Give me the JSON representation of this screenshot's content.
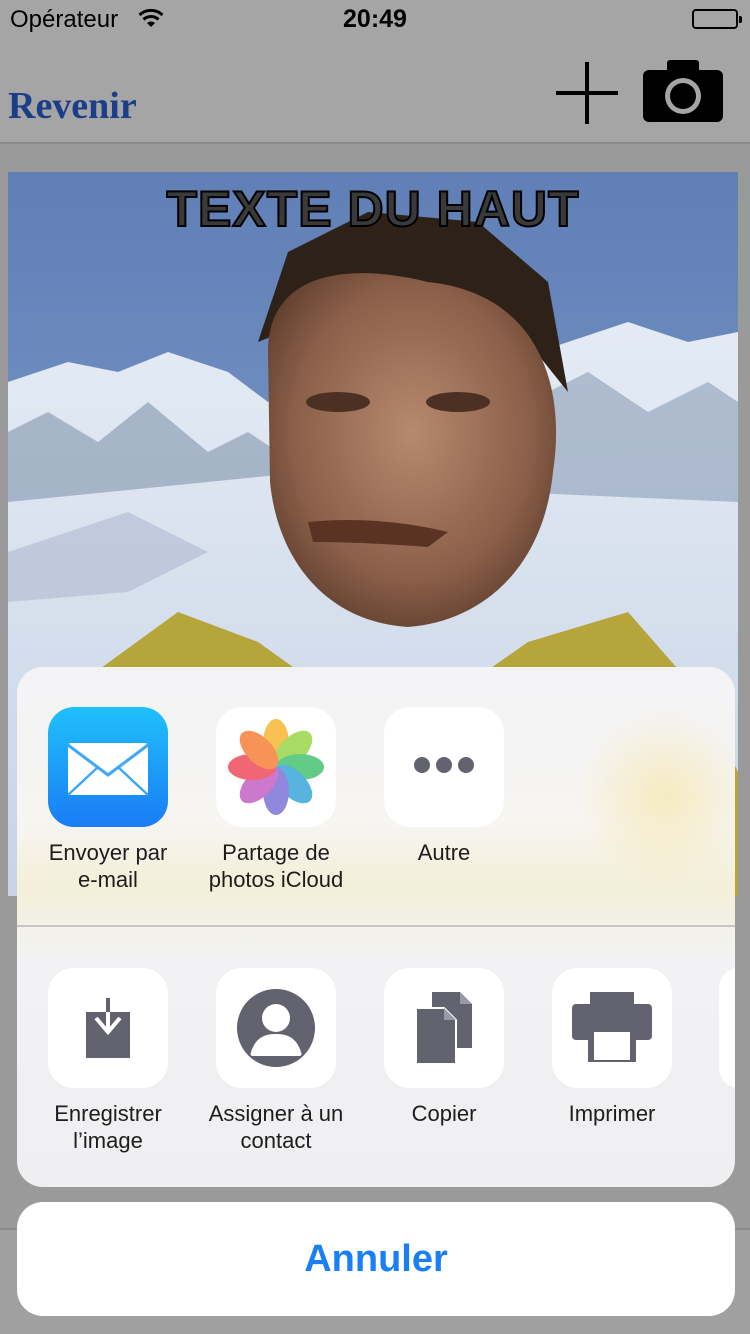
{
  "status_bar": {
    "carrier": "Opérateur",
    "time": "20:49"
  },
  "nav": {
    "back_label": "Revenir",
    "add_icon": "plus-icon",
    "camera_icon": "camera-icon"
  },
  "meme": {
    "top_text": "TEXTE DU HAUT"
  },
  "share_sheet": {
    "apps": [
      {
        "label": "Envoyer par\ne-mail",
        "icon": "mail-icon"
      },
      {
        "label": "Partage de\nphotos iCloud",
        "icon": "photos-icon"
      },
      {
        "label": "Autre",
        "icon": "more-icon"
      }
    ],
    "actions": [
      {
        "label": "Enregistrer\nl’image",
        "icon": "save-image-icon"
      },
      {
        "label": "Assigner à un\ncontact",
        "icon": "contact-icon"
      },
      {
        "label": "Copier",
        "icon": "copy-icon"
      },
      {
        "label": "Imprimer",
        "icon": "print-icon"
      }
    ],
    "cancel_label": "Annuler"
  },
  "colors": {
    "accent": "#1a7ef5",
    "back_link": "#1a3f88",
    "icon_gray": "#636370"
  }
}
